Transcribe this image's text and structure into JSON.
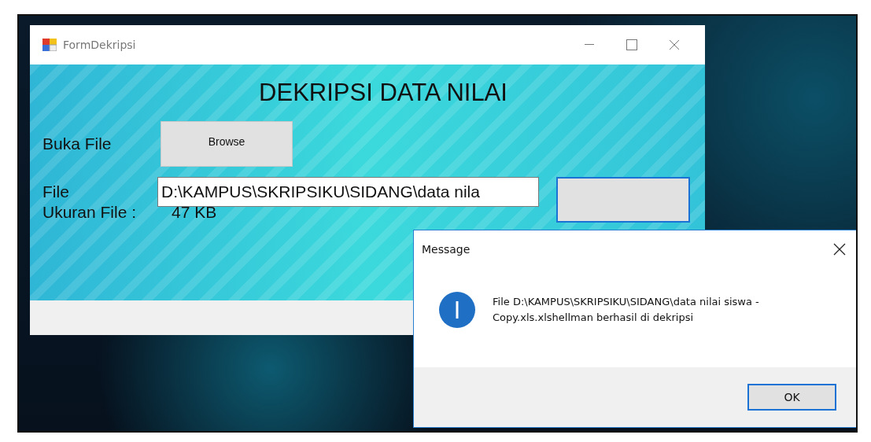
{
  "form": {
    "title": "FormDekripsi",
    "heading": "DEKRIPSI DATA NILAI",
    "rows": [
      {
        "kind": "button",
        "label": "Buka File",
        "button": "Browse"
      },
      {
        "kind": "field",
        "label": "File",
        "value": "D:\\KAMPUS\\SKRIPSIKU\\SIDANG\\data nila"
      },
      {
        "kind": "text",
        "label": "Ukuran File :",
        "value": "47 KB"
      }
    ]
  },
  "dialog": {
    "title": "Message",
    "message": "File D:\\KAMPUS\\SKRIPSIKU\\SIDANG\\data nilai siswa - Copy.xls.xlshellman berhasil di dekripsi",
    "button": "OK"
  }
}
